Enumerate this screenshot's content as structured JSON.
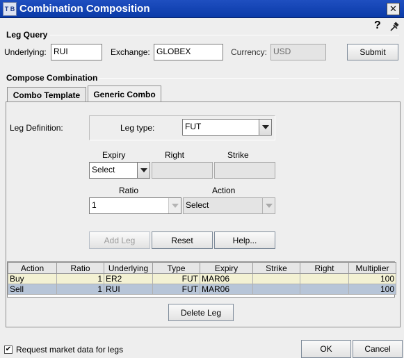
{
  "window": {
    "title": "Combination Composition",
    "icon_text": "T B",
    "close": "✕"
  },
  "toolbar": {
    "help": "?"
  },
  "leg_query": {
    "title": "Leg Query",
    "underlying_label": "Underlying:",
    "underlying_value": "RUI",
    "exchange_label": "Exchange:",
    "exchange_value": "GLOBEX",
    "currency_label": "Currency:",
    "currency_value": "USD",
    "submit": "Submit"
  },
  "compose": {
    "title": "Compose Combination",
    "tabs": [
      {
        "label": "Combo Template",
        "active": false
      },
      {
        "label": "Generic Combo",
        "active": true
      }
    ],
    "leg_definition_label": "Leg Definition:",
    "leg_type_label": "Leg type:",
    "leg_type_value": "FUT",
    "expiry_label": "Expiry",
    "expiry_value": "Select",
    "right_label": "Right",
    "right_value": "",
    "strike_label": "Strike",
    "strike_value": "",
    "ratio_label": "Ratio",
    "ratio_value": "1",
    "action_label": "Action",
    "action_value": "Select",
    "buttons": {
      "add_leg": "Add Leg",
      "reset": "Reset",
      "help": "Help..."
    }
  },
  "legs_table": {
    "columns": [
      "Action",
      "Ratio",
      "Underlying",
      "Type",
      "Expiry",
      "Strike",
      "Right",
      "Multiplier"
    ],
    "rows": [
      {
        "action": "Buy",
        "ratio": "1",
        "underlying": "ER2",
        "type": "FUT",
        "expiry": "MAR06",
        "strike": "",
        "right": "",
        "multiplier": "100"
      },
      {
        "action": "Sell",
        "ratio": "1",
        "underlying": "RUI",
        "type": "FUT",
        "expiry": "MAR06",
        "strike": "",
        "right": "",
        "multiplier": "100"
      }
    ],
    "delete_leg": "Delete Leg"
  },
  "footer": {
    "request_market_data_label": "Request market data for legs",
    "request_market_data_checked": true,
    "check_mark": "✔",
    "ok": "OK",
    "cancel": "Cancel"
  },
  "colors": {
    "titlebar": "#0a3aa8",
    "row_buy": "#f3f1d3",
    "row_sell_selected": "#b7c5d8"
  }
}
